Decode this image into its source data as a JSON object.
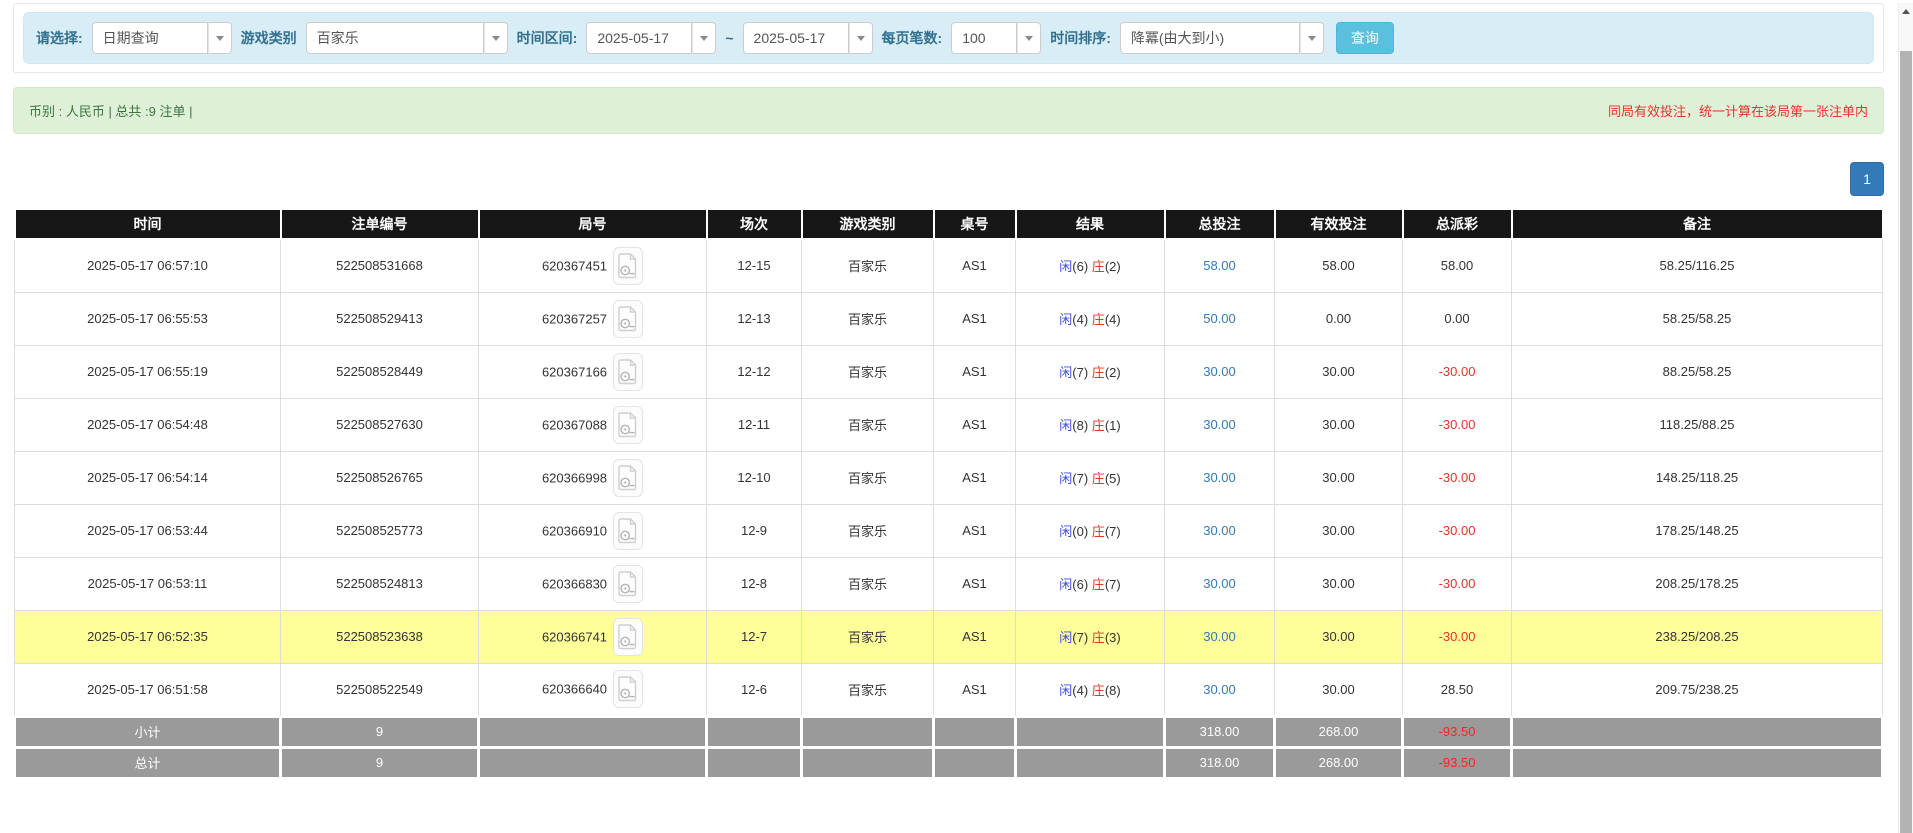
{
  "filter": {
    "select_label": "请选择:",
    "select_value": "日期查询",
    "game_type_label": "游戏类别",
    "game_type_value": "百家乐",
    "time_range_label": "时间区间:",
    "date_from": "2025-05-17",
    "tilde": "~",
    "date_to": "2025-05-17",
    "page_size_label": "每页笔数:",
    "page_size_value": "100",
    "sort_label": "时间排序:",
    "sort_value": "降冪(由大到小)",
    "search_button": "查询"
  },
  "summary": {
    "left": "币别 : 人民币 | 总共 :9 注单 |",
    "right": "同局有效投注，统一计算在该局第一张注单内"
  },
  "pagination": {
    "page": "1"
  },
  "table": {
    "headers": [
      "时间",
      "注单编号",
      "局号",
      "场次",
      "游戏类别",
      "桌号",
      "结果",
      "总投注",
      "有效投注",
      "总派彩",
      "备注"
    ],
    "rows": [
      {
        "time": "2025-05-17 06:57:10",
        "bet_id": "522508531668",
        "round_id": "620367451",
        "session": "12-15",
        "game": "百家乐",
        "table_no": "AS1",
        "player_label": "闲",
        "player_score": "(6)",
        "banker_label": "庄",
        "banker_score": "(2)",
        "total_bet": "58.00",
        "valid_bet": "58.00",
        "payout": "58.00",
        "remark": "58.25/116.25",
        "highlighted": false
      },
      {
        "time": "2025-05-17 06:55:53",
        "bet_id": "522508529413",
        "round_id": "620367257",
        "session": "12-13",
        "game": "百家乐",
        "table_no": "AS1",
        "player_label": "闲",
        "player_score": "(4)",
        "banker_label": "庄",
        "banker_score": "(4)",
        "total_bet": "50.00",
        "valid_bet": "0.00",
        "payout": "0.00",
        "remark": "58.25/58.25",
        "highlighted": false
      },
      {
        "time": "2025-05-17 06:55:19",
        "bet_id": "522508528449",
        "round_id": "620367166",
        "session": "12-12",
        "game": "百家乐",
        "table_no": "AS1",
        "player_label": "闲",
        "player_score": "(7)",
        "banker_label": "庄",
        "banker_score": "(2)",
        "total_bet": "30.00",
        "valid_bet": "30.00",
        "payout": "-30.00",
        "remark": "88.25/58.25",
        "highlighted": false
      },
      {
        "time": "2025-05-17 06:54:48",
        "bet_id": "522508527630",
        "round_id": "620367088",
        "session": "12-11",
        "game": "百家乐",
        "table_no": "AS1",
        "player_label": "闲",
        "player_score": "(8)",
        "banker_label": "庄",
        "banker_score": "(1)",
        "total_bet": "30.00",
        "valid_bet": "30.00",
        "payout": "-30.00",
        "remark": "118.25/88.25",
        "highlighted": false
      },
      {
        "time": "2025-05-17 06:54:14",
        "bet_id": "522508526765",
        "round_id": "620366998",
        "session": "12-10",
        "game": "百家乐",
        "table_no": "AS1",
        "player_label": "闲",
        "player_score": "(7)",
        "banker_label": "庄",
        "banker_score": "(5)",
        "total_bet": "30.00",
        "valid_bet": "30.00",
        "payout": "-30.00",
        "remark": "148.25/118.25",
        "highlighted": false
      },
      {
        "time": "2025-05-17 06:53:44",
        "bet_id": "522508525773",
        "round_id": "620366910",
        "session": "12-9",
        "game": "百家乐",
        "table_no": "AS1",
        "player_label": "闲",
        "player_score": "(0)",
        "banker_label": "庄",
        "banker_score": "(7)",
        "total_bet": "30.00",
        "valid_bet": "30.00",
        "payout": "-30.00",
        "remark": "178.25/148.25",
        "highlighted": false
      },
      {
        "time": "2025-05-17 06:53:11",
        "bet_id": "522508524813",
        "round_id": "620366830",
        "session": "12-8",
        "game": "百家乐",
        "table_no": "AS1",
        "player_label": "闲",
        "player_score": "(6)",
        "banker_label": "庄",
        "banker_score": "(7)",
        "total_bet": "30.00",
        "valid_bet": "30.00",
        "payout": "-30.00",
        "remark": "208.25/178.25",
        "highlighted": false
      },
      {
        "time": "2025-05-17 06:52:35",
        "bet_id": "522508523638",
        "round_id": "620366741",
        "session": "12-7",
        "game": "百家乐",
        "table_no": "AS1",
        "player_label": "闲",
        "player_score": "(7)",
        "banker_label": "庄",
        "banker_score": "(3)",
        "total_bet": "30.00",
        "valid_bet": "30.00",
        "payout": "-30.00",
        "remark": "238.25/208.25",
        "highlighted": true
      },
      {
        "time": "2025-05-17 06:51:58",
        "bet_id": "522508522549",
        "round_id": "620366640",
        "session": "12-6",
        "game": "百家乐",
        "table_no": "AS1",
        "player_label": "闲",
        "player_score": "(4)",
        "banker_label": "庄",
        "banker_score": "(8)",
        "total_bet": "30.00",
        "valid_bet": "30.00",
        "payout": "28.50",
        "remark": "209.75/238.25",
        "highlighted": false
      }
    ],
    "footer": [
      {
        "label": "小计",
        "count": "9",
        "total_bet": "318.00",
        "valid_bet": "268.00",
        "payout": "-93.50"
      },
      {
        "label": "总计",
        "count": "9",
        "total_bet": "318.00",
        "valid_bet": "268.00",
        "payout": "-93.50"
      }
    ]
  },
  "icons": {
    "combo_arrow": "chevron-down-icon",
    "round_video": "film-file-icon",
    "scroll_up": "arrow-up-icon"
  },
  "colors": {
    "panel_blue": "#d9edf7",
    "label_blue": "#31708f",
    "button_info": "#5bc0de",
    "alert_green_bg": "#dff0d8",
    "alert_green_text": "#3c763d",
    "warning_red": "#e8322d",
    "link_blue": "#337ab7",
    "result_player_blue": "#3d4fe0",
    "result_banker_red": "#e8322d",
    "highlight_yellow": "#ffff99",
    "header_black": "#171717",
    "footer_gray": "#9a9a9a"
  }
}
